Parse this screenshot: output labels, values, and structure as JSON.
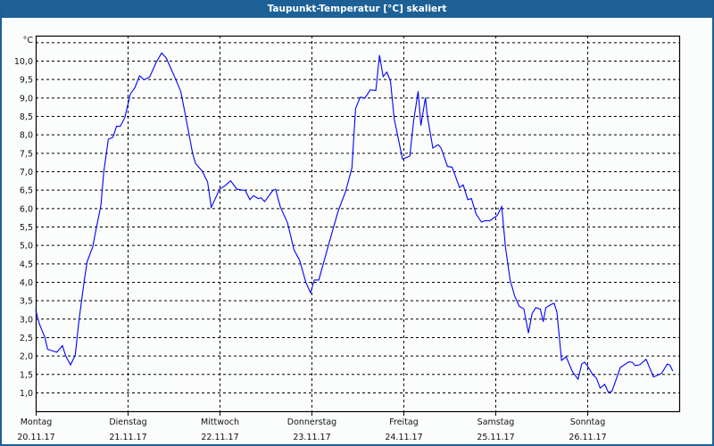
{
  "title": "Taupunkt-Temperatur [°C] skaliert",
  "colors": {
    "title_bar": "#1d6197",
    "line": "#0000ff",
    "grid": "#000000"
  },
  "chart_data": {
    "type": "line",
    "title": "Taupunkt-Temperatur [°C] skaliert",
    "ylabel": "°C",
    "xlabel": "",
    "xlim": [
      0,
      7
    ],
    "ylim": [
      0.5,
      10.68
    ],
    "grid": true,
    "x_unit": "days since Montag 20.11.17 00:00",
    "y_ticks": [
      1.0,
      1.5,
      2.0,
      2.5,
      3.0,
      3.5,
      4.0,
      4.5,
      5.0,
      5.5,
      6.0,
      6.5,
      7.0,
      7.5,
      8.0,
      8.5,
      9.0,
      9.5,
      10.0
    ],
    "y_tick_labels": [
      "1,0",
      "1,5",
      "2,0",
      "2,5",
      "3,0",
      "3,5",
      "4,0",
      "4,5",
      "5,0",
      "5,5",
      "6,0",
      "6,5",
      "7,0",
      "7,5",
      "8,0",
      "8,5",
      "9,0",
      "9,5",
      "10,0"
    ],
    "y_top_gridline": 10.5,
    "x_ticks": [
      {
        "day": "Montag",
        "date": "20.11.17"
      },
      {
        "day": "Dienstag",
        "date": "21.11.17"
      },
      {
        "day": "Mittwoch",
        "date": "22.11.17"
      },
      {
        "day": "Donnerstag",
        "date": "23.11.17"
      },
      {
        "day": "Freitag",
        "date": "24.11.17"
      },
      {
        "day": "Samstag",
        "date": "25.11.17"
      },
      {
        "day": "Sonntag",
        "date": "26.11.17"
      }
    ],
    "series": [
      {
        "name": "Taupunkt",
        "x": [
          0.0,
          0.04,
          0.1,
          0.13,
          0.23,
          0.29,
          0.33,
          0.38,
          0.43,
          0.47,
          0.53,
          0.56,
          0.62,
          0.65,
          0.71,
          0.74,
          0.79,
          0.84,
          0.88,
          0.92,
          0.97,
          1.03,
          1.08,
          1.13,
          1.18,
          1.24,
          1.31,
          1.37,
          1.42,
          1.52,
          1.58,
          1.63,
          1.71,
          1.74,
          1.81,
          1.87,
          1.91,
          2.0,
          2.06,
          2.12,
          2.19,
          2.28,
          2.33,
          2.37,
          2.42,
          2.45,
          2.49,
          2.58,
          2.61,
          2.66,
          2.74,
          2.81,
          2.87,
          2.94,
          2.99,
          3.03,
          3.08,
          3.18,
          3.29,
          3.37,
          3.44,
          3.48,
          3.53,
          3.58,
          3.64,
          3.7,
          3.74,
          3.78,
          3.82,
          3.86,
          3.9,
          3.99,
          4.07,
          4.11,
          4.16,
          4.19,
          4.24,
          4.26,
          4.32,
          4.38,
          4.41,
          4.48,
          4.53,
          4.61,
          4.65,
          4.7,
          4.74,
          4.79,
          4.85,
          4.89,
          4.94,
          5.02,
          5.07,
          5.11,
          5.16,
          5.21,
          5.26,
          5.31,
          5.36,
          5.4,
          5.44,
          5.49,
          5.52,
          5.55,
          5.6,
          5.64,
          5.67,
          5.72,
          5.77,
          5.84,
          5.9,
          5.94,
          5.97,
          6.0,
          6.06,
          6.1,
          6.14,
          6.19,
          6.23,
          6.27,
          6.36,
          6.45,
          6.49,
          6.52,
          6.57,
          6.64,
          6.72,
          6.81,
          6.87,
          6.9,
          6.93
        ],
        "y": [
          3.23,
          2.86,
          2.49,
          2.17,
          2.09,
          2.27,
          1.97,
          1.75,
          2.01,
          2.94,
          4.07,
          4.55,
          4.95,
          5.35,
          6.08,
          6.97,
          7.87,
          7.92,
          8.22,
          8.22,
          8.46,
          9.1,
          9.27,
          9.59,
          9.48,
          9.56,
          9.95,
          10.21,
          10.07,
          9.51,
          9.15,
          8.5,
          7.45,
          7.21,
          7.01,
          6.71,
          6.02,
          6.51,
          6.61,
          6.74,
          6.51,
          6.48,
          6.23,
          6.34,
          6.26,
          6.28,
          6.18,
          6.48,
          6.51,
          6.04,
          5.6,
          4.87,
          4.59,
          3.98,
          3.7,
          4.05,
          4.05,
          4.95,
          5.92,
          6.44,
          7.09,
          8.7,
          9.01,
          8.98,
          9.21,
          9.19,
          10.15,
          9.57,
          9.69,
          9.43,
          8.42,
          7.33,
          7.41,
          8.34,
          9.17,
          8.24,
          9.0,
          8.5,
          7.63,
          7.72,
          7.63,
          7.13,
          7.11,
          6.56,
          6.63,
          6.23,
          6.26,
          5.84,
          5.62,
          5.66,
          5.66,
          5.8,
          6.04,
          4.95,
          4.06,
          3.62,
          3.34,
          3.27,
          2.61,
          3.14,
          3.3,
          3.26,
          2.92,
          3.3,
          3.38,
          3.42,
          3.18,
          1.87,
          1.97,
          1.56,
          1.36,
          1.77,
          1.82,
          1.73,
          1.48,
          1.39,
          1.12,
          1.22,
          1.0,
          1.04,
          1.68,
          1.83,
          1.82,
          1.73,
          1.75,
          1.9,
          1.42,
          1.52,
          1.77,
          1.74,
          1.58
        ]
      }
    ]
  }
}
